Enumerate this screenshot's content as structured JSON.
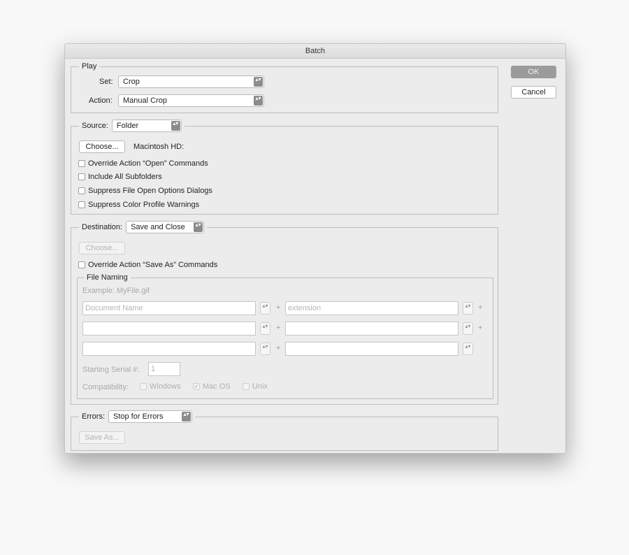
{
  "dialog": {
    "title": "Batch"
  },
  "buttons": {
    "ok": "OK",
    "cancel": "Cancel"
  },
  "play": {
    "legend": "Play",
    "set_label": "Set:",
    "set_value": "Crop",
    "action_label": "Action:",
    "action_value": "Manual Crop"
  },
  "source": {
    "label": "Source:",
    "value": "Folder",
    "choose": "Choose...",
    "path": "Macintosh HD:",
    "checkboxes": [
      {
        "label": "Override Action “Open” Commands",
        "checked": false
      },
      {
        "label": "Include All Subfolders",
        "checked": false
      },
      {
        "label": "Suppress File Open Options Dialogs",
        "checked": false
      },
      {
        "label": "Suppress Color Profile Warnings",
        "checked": false
      }
    ]
  },
  "destination": {
    "label": "Destination:",
    "value": "Save and Close",
    "choose": "Choose...",
    "override": {
      "label": "Override Action “Save As” Commands",
      "checked": false
    },
    "file_naming": {
      "legend": "File Naming",
      "example": "Example: MyFile.gif",
      "fields": [
        {
          "placeholder": "Document Name",
          "value": ""
        },
        {
          "placeholder": "extension",
          "value": ""
        },
        {
          "placeholder": "",
          "value": ""
        },
        {
          "placeholder": "",
          "value": ""
        },
        {
          "placeholder": "",
          "value": ""
        },
        {
          "placeholder": "",
          "value": ""
        }
      ],
      "plus": "+",
      "serial_label": "Starting Serial #:",
      "serial_value": "1",
      "compat_label": "Compatibility:",
      "compat": [
        {
          "label": "Windows",
          "checked": false
        },
        {
          "label": "Mac OS",
          "checked": true
        },
        {
          "label": "Unix",
          "checked": false
        }
      ]
    }
  },
  "errors": {
    "label": "Errors:",
    "value": "Stop for Errors",
    "save_as": "Save As..."
  },
  "icons": {
    "select_arrows": "▴▾",
    "checkmark": "✓"
  }
}
